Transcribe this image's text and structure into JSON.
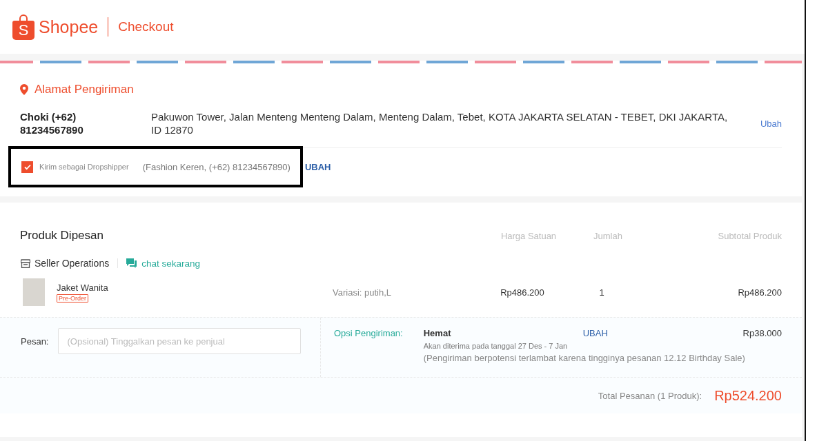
{
  "header": {
    "logo_letter": "S",
    "brand": "Shopee",
    "page_title": "Checkout"
  },
  "address": {
    "title": "Alamat Pengiriman",
    "name_phone": "Choki (+62) 81234567890",
    "address": "Pakuwon Tower, Jalan Menteng Menteng Dalam, Menteng Dalam, Tebet, KOTA JAKARTA SELATAN - TEBET, DKI JAKARTA, ID 12870",
    "change": "Ubah"
  },
  "dropship": {
    "checked": true,
    "label": "Kirim sebagai Dropshipper",
    "info": "(Fashion Keren, (+62) 81234567890)",
    "change": "UBAH",
    "highlighted": true
  },
  "products": {
    "title": "Produk Dipesan",
    "columns": [
      "Harga Satuan",
      "Jumlah",
      "Subtotal Produk"
    ],
    "shop": "Seller Operations",
    "chat": "chat sekarang",
    "items": [
      {
        "name": "Jaket Wanita",
        "badge": "Pre-Order",
        "variant": "Variasi: putih,L",
        "price": "Rp486.200",
        "qty": "1",
        "subtotal": "Rp486.200"
      }
    ]
  },
  "message": {
    "label": "Pesan:",
    "placeholder": "(Opsional) Tinggalkan pesan ke penjual"
  },
  "shipping": {
    "label": "Opsi Pengiriman:",
    "name": "Hemat",
    "change": "UBAH",
    "price": "Rp38.000",
    "eta": "Akan diterima pada tanggal 27 Des - 7 Jan",
    "note": "(Pengiriman berpotensi terlambat karena tingginya pesanan 12.12 Birthday Sale)"
  },
  "total": {
    "label": "Total Pesanan (1 Produk):",
    "value": "Rp524.200"
  }
}
